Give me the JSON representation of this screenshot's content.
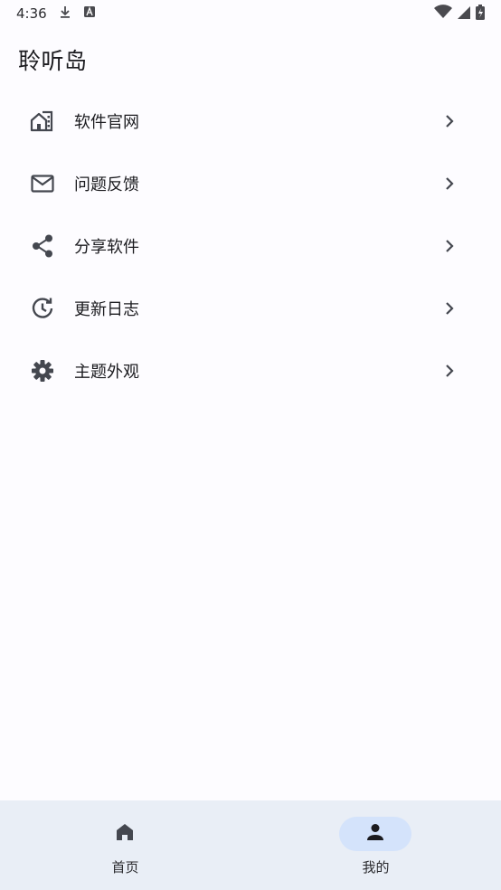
{
  "status_bar": {
    "time": "4:36",
    "icons_left": [
      "download-icon",
      "font-a-icon"
    ],
    "icons_right": [
      "wifi-icon",
      "signal-icon",
      "battery-charging-icon"
    ]
  },
  "app": {
    "title": "聆听岛"
  },
  "menu": {
    "items": [
      {
        "label": "软件官网",
        "icon": "building-icon"
      },
      {
        "label": "问题反馈",
        "icon": "mail-icon"
      },
      {
        "label": "分享软件",
        "icon": "share-icon"
      },
      {
        "label": "更新日志",
        "icon": "history-icon"
      },
      {
        "label": "主题外观",
        "icon": "gear-icon"
      }
    ]
  },
  "bottom_nav": {
    "items": [
      {
        "label": "首页",
        "icon": "home-icon",
        "active": false
      },
      {
        "label": "我的",
        "icon": "person-icon",
        "active": true
      }
    ]
  },
  "colors": {
    "background": "#fdfcff",
    "nav_background": "#e9eef6",
    "active_pill": "#d4e3fb",
    "icon": "#44474f",
    "text": "#1b1b1f"
  }
}
